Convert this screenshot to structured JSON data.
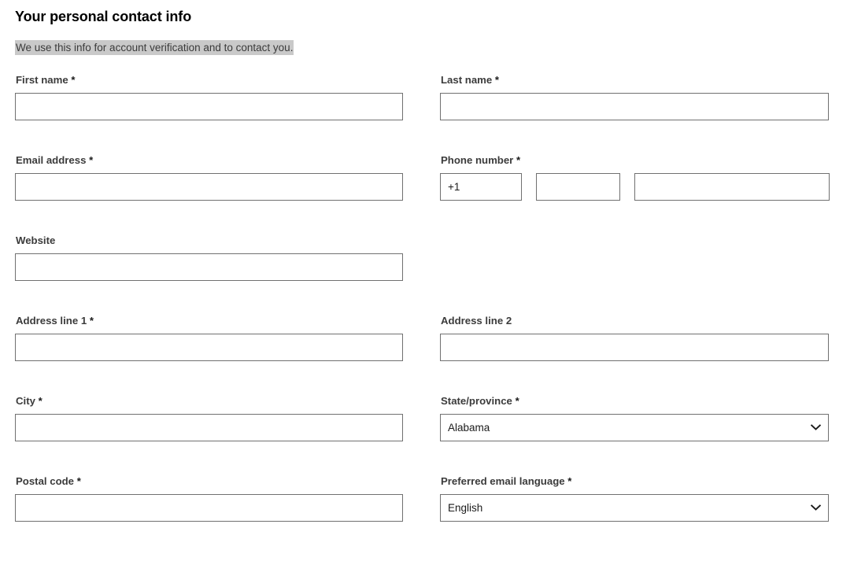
{
  "form": {
    "heading": "Your personal contact info",
    "subtitle": "We use this info for account verification and to contact you.",
    "required_marker": "*",
    "colors": {
      "heading_text": "#000000",
      "label_text": "#3b3b3b",
      "input_border": "#707070",
      "subtitle_highlight": "#c9c9c9",
      "page_background": "#ffffff"
    },
    "fields": {
      "first_name": {
        "label": "First name",
        "required": true,
        "value": "",
        "placeholder": ""
      },
      "last_name": {
        "label": "Last name",
        "required": true,
        "value": "",
        "placeholder": ""
      },
      "email_address": {
        "label": "Email address",
        "required": true,
        "value": "",
        "placeholder": ""
      },
      "phone_number": {
        "label": "Phone number",
        "required": true,
        "country_code": "+1",
        "area_code": "",
        "line_number": ""
      },
      "website": {
        "label": "Website",
        "required": false,
        "value": "",
        "placeholder": ""
      },
      "address_line_1": {
        "label": "Address line 1",
        "required": true,
        "value": "",
        "placeholder": ""
      },
      "address_line_2": {
        "label": "Address line 2",
        "required": false,
        "value": "",
        "placeholder": ""
      },
      "city": {
        "label": "City",
        "required": true,
        "value": "",
        "placeholder": ""
      },
      "state_province": {
        "label": "State/province",
        "required": true,
        "selected": "Alabama",
        "icon": "chevron-down-icon"
      },
      "postal_code": {
        "label": "Postal code",
        "required": true,
        "value": "",
        "placeholder": ""
      },
      "preferred_email_language": {
        "label": "Preferred email language",
        "required": true,
        "selected": "English",
        "icon": "chevron-down-icon"
      }
    }
  }
}
